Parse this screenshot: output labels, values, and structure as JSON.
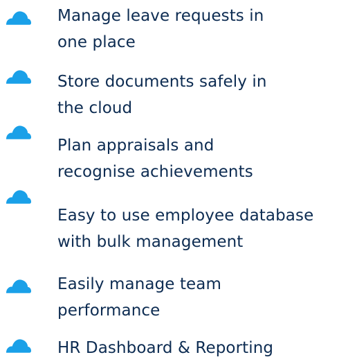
{
  "theme": {
    "icon_color": "#1aa0e8",
    "text_color": "#0d2c52"
  },
  "features": [
    {
      "icon": "cloud-icon",
      "lines": [
        "Manage leave requests in",
        "one place"
      ]
    },
    {
      "icon": "cloud-icon",
      "lines": [
        "Store documents safely in",
        "the cloud"
      ]
    },
    {
      "icon": "cloud-icon",
      "lines": [
        "Plan appraisals and",
        "recognise achievements"
      ]
    },
    {
      "icon": "cloud-icon",
      "lines": [
        "Easy to use employee database",
        "with bulk management"
      ]
    },
    {
      "icon": "cloud-icon",
      "lines": [
        "Easily manage team",
        "performance"
      ]
    },
    {
      "icon": "cloud-icon",
      "lines": [
        "HR Dashboard & Reporting"
      ]
    }
  ]
}
